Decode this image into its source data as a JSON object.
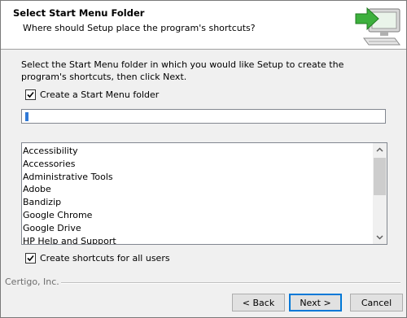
{
  "header": {
    "title": "Select Start Menu Folder",
    "subtitle": "Where should Setup place the program's shortcuts?"
  },
  "instructions": "Select the Start Menu folder in which you would like Setup to create the program's shortcuts, then click Next.",
  "create_folder": {
    "label": "Create a Start Menu folder",
    "checked": true
  },
  "folder_input": {
    "value": ""
  },
  "folder_list": {
    "items": [
      "Accessibility",
      "Accessories",
      "Administrative Tools",
      "Adobe",
      "Bandizip",
      "Google Chrome",
      "Google Drive",
      "HP Help and Support"
    ]
  },
  "all_users": {
    "label": "Create shortcuts for all users",
    "checked": true
  },
  "footer": {
    "company": "Certigo, Inc.",
    "back_label": "< Back",
    "next_label": "Next >",
    "cancel_label": "Cancel"
  },
  "colors": {
    "accent": "#0078d7",
    "green_arrow": "#3db03d"
  }
}
